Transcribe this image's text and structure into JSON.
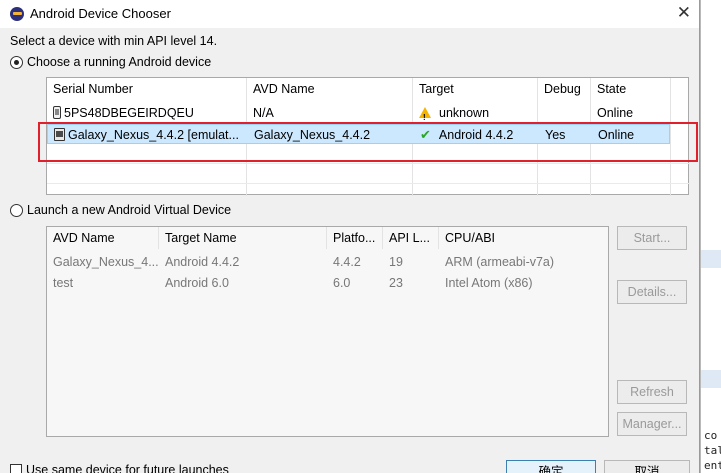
{
  "dialog": {
    "title": "Android Device Chooser",
    "description": "Select a device with min API level 14.",
    "choose_running_label": "Choose a running Android device",
    "launch_new_label": "Launch a new Android Virtual Device",
    "future_checkbox_label": "Use same device for future launches",
    "ok_label": "确定",
    "cancel_label": "取消"
  },
  "running_table": {
    "columns": [
      "Serial Number",
      "AVD Name",
      "Target",
      "Debug",
      "State"
    ],
    "rows": [
      {
        "serial": "5PS48DBEGEIRDQEU",
        "avd": "N/A",
        "target": "unknown",
        "debug": "",
        "state": "Online",
        "icon": "phone-icon",
        "target_icon": "warning-icon",
        "selected": false
      },
      {
        "serial": "Galaxy_Nexus_4.4.2 [emulat...",
        "avd": "Galaxy_Nexus_4.4.2",
        "target": "Android 4.4.2",
        "debug": "Yes",
        "state": "Online",
        "icon": "emulator-icon",
        "target_icon": "check-icon",
        "selected": true
      }
    ]
  },
  "avd_table": {
    "columns": [
      "AVD Name",
      "Target Name",
      "Platfo...",
      "API L...",
      "CPU/ABI"
    ],
    "rows": [
      {
        "name": "Galaxy_Nexus_4...",
        "target": "Android 4.4.2",
        "platform": "4.4.2",
        "api": "19",
        "cpu": "ARM (armeabi-v7a)"
      },
      {
        "name": "test",
        "target": "Android 6.0",
        "platform": "6.0",
        "api": "23",
        "cpu": "Intel Atom (x86)"
      }
    ]
  },
  "side_buttons": {
    "start": "Start...",
    "details": "Details...",
    "refresh": "Refresh",
    "manager": "Manager..."
  },
  "background_code": [
    "co",
    "tal",
    "ent"
  ],
  "colors": {
    "selection": "#cce8ff",
    "highlight_box": "#e0202a",
    "ok_check": "#2aa52a",
    "warning": "#f5b400"
  }
}
